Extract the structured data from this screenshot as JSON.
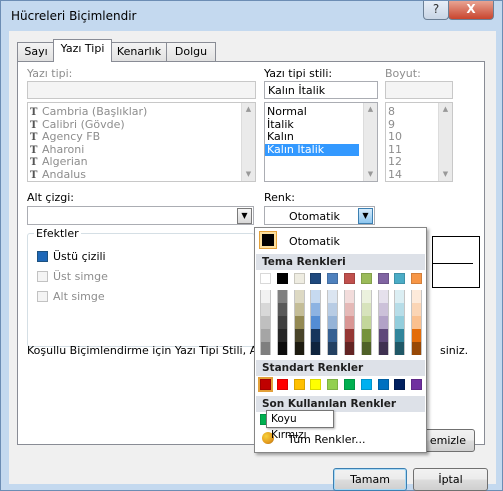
{
  "window": {
    "title": "Hücreleri Biçimlendir",
    "help": "?",
    "close": "X"
  },
  "tabs": [
    {
      "label": "Sayı"
    },
    {
      "label": "Yazı Tipi"
    },
    {
      "label": "Kenarlık"
    },
    {
      "label": "Dolgu"
    }
  ],
  "font": {
    "label": "Yazı tipi:",
    "value": "",
    "items": [
      "Cambria (Başlıklar)",
      "Calibri (Gövde)",
      "Agency FB",
      "Aharoni",
      "Algerian",
      "Andalus"
    ]
  },
  "style": {
    "label": "Yazı tipi stili:",
    "value": "Kalın İtalik",
    "items": [
      "Normal",
      "İtalik",
      "Kalın",
      "Kalın İtalik"
    ]
  },
  "size": {
    "label": "Boyut:",
    "value": "",
    "items": [
      "8",
      "9",
      "10",
      "11",
      "12",
      "14"
    ]
  },
  "underline": {
    "label": "Alt çizgi:",
    "value": ""
  },
  "color": {
    "label": "Renk:",
    "value": "Otomatik"
  },
  "effects": {
    "title": "Efektler",
    "strikethrough": "Üstü çizili",
    "superscript": "Üst simge",
    "subscript": "Alt simge"
  },
  "description": "Koşullu Biçimlendirme için Yazı Tipi Stili, Alt çizgi, R",
  "description_tail": "siniz.",
  "clear_button": "emizle",
  "ok_button": "Tamam",
  "cancel_button": "İptal",
  "palette": {
    "automatic": "Otomatik",
    "theme_header": "Tema Renkleri",
    "standard_header": "Standart Renkler",
    "recent_header": "Son Kullanılan Renkler",
    "more_colors": "Tüm Renkler...",
    "theme_colors": [
      "#ffffff",
      "#000000",
      "#eeece1",
      "#1f497d",
      "#4f81bd",
      "#c0504d",
      "#9bbb59",
      "#8064a2",
      "#4bacc6",
      "#f79646"
    ],
    "theme_shades": [
      [
        "#f2f2f2",
        "#d8d8d8",
        "#bfbfbf",
        "#a5a5a5",
        "#7f7f7f"
      ],
      [
        "#7f7f7f",
        "#595959",
        "#3f3f3f",
        "#262626",
        "#0c0c0c"
      ],
      [
        "#ddd9c3",
        "#c4bd97",
        "#938953",
        "#494429",
        "#1d1b10"
      ],
      [
        "#c6d9f0",
        "#8db3e2",
        "#548dd4",
        "#17365d",
        "#0f243e"
      ],
      [
        "#dbe5f1",
        "#b8cce4",
        "#95b3d7",
        "#366092",
        "#244061"
      ],
      [
        "#f2dcdb",
        "#e5b9b7",
        "#d99694",
        "#953734",
        "#632423"
      ],
      [
        "#ebf1dd",
        "#d7e3bc",
        "#c3d69b",
        "#76923c",
        "#4f6128"
      ],
      [
        "#e5e0ec",
        "#ccc1d9",
        "#b2a2c7",
        "#5f497a",
        "#3f3151"
      ],
      [
        "#dbeef3",
        "#b7dde8",
        "#92cddc",
        "#31859b",
        "#205867"
      ],
      [
        "#fdeada",
        "#fbd5b5",
        "#fac08f",
        "#e36c09",
        "#974806"
      ]
    ],
    "standard_colors": [
      "#c00000",
      "#ff0000",
      "#ffc000",
      "#ffff00",
      "#92d050",
      "#00b050",
      "#00b0f0",
      "#0070c0",
      "#002060",
      "#7030a0"
    ],
    "recent_colors": [
      "#00b050"
    ]
  },
  "tooltip": "Koyu Kırmızı"
}
